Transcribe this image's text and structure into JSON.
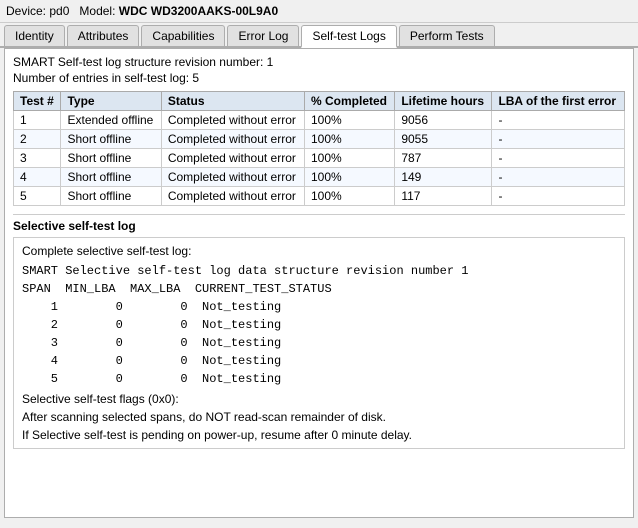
{
  "device": {
    "label_device": "Device:",
    "device_id": "pd0",
    "label_model": "Model:",
    "model_name": "WDC WD3200AAKS-00L9A0"
  },
  "tabs": [
    {
      "id": "identity",
      "label": "Identity",
      "active": false
    },
    {
      "id": "attributes",
      "label": "Attributes",
      "active": false
    },
    {
      "id": "capabilities",
      "label": "Capabilities",
      "active": false
    },
    {
      "id": "error-log",
      "label": "Error Log",
      "active": false
    },
    {
      "id": "self-test-logs",
      "label": "Self-test Logs",
      "active": true
    },
    {
      "id": "perform-tests",
      "label": "Perform Tests",
      "active": false
    }
  ],
  "smart_info": {
    "revision_text": "SMART Self-test log structure revision number: 1",
    "entries_text": "Number of entries in self-test log: 5"
  },
  "table": {
    "headers": [
      "Test #",
      "Type",
      "Status",
      "% Completed",
      "Lifetime hours",
      "LBA of the first error"
    ],
    "rows": [
      {
        "num": "1",
        "type": "Extended offline",
        "status": "Completed without error",
        "pct": "100%",
        "hours": "9056",
        "lba": "-"
      },
      {
        "num": "2",
        "type": "Short offline",
        "status": "Completed without error",
        "pct": "100%",
        "hours": "9055",
        "lba": "-"
      },
      {
        "num": "3",
        "type": "Short offline",
        "status": "Completed without error",
        "pct": "100%",
        "hours": "787",
        "lba": "-"
      },
      {
        "num": "4",
        "type": "Short offline",
        "status": "Completed without error",
        "pct": "100%",
        "hours": "149",
        "lba": "-"
      },
      {
        "num": "5",
        "type": "Short offline",
        "status": "Completed without error",
        "pct": "100%",
        "hours": "117",
        "lba": "-"
      }
    ]
  },
  "selective": {
    "section_title": "Selective self-test log",
    "complete_label": "Complete selective self-test log:",
    "mono_block": "SMART Selective self-test log data structure revision number 1\nSPAN  MIN_LBA  MAX_LBA  CURRENT_TEST_STATUS\n    1        0        0  Not_testing\n    2        0        0  Not_testing\n    3        0        0  Not_testing\n    4        0        0  Not_testing\n    5        0        0  Not_testing",
    "flags_text": "Selective self-test flags (0x0):",
    "note1": "  After scanning selected spans, do NOT read-scan remainder of disk.",
    "note2": "If Selective self-test is pending on power-up, resume after 0 minute delay."
  }
}
